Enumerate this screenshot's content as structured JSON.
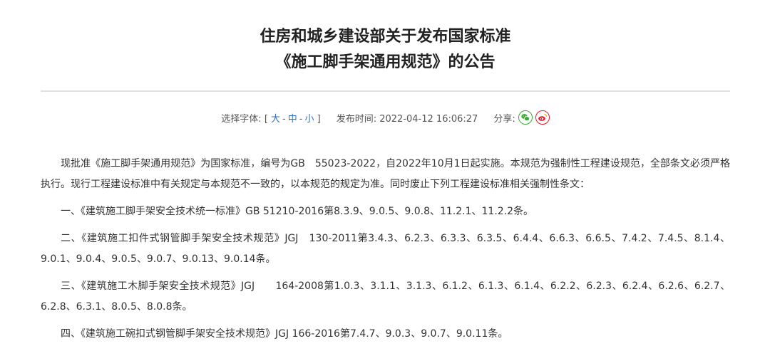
{
  "article": {
    "title_line1": "住房和城乡建设部关于发布国家标准",
    "title_line2": "《施工脚手架通用规范》的公告"
  },
  "meta": {
    "font_label": "选择字体:",
    "bracket_open": "[",
    "bracket_close": "]",
    "size_large": "大",
    "size_medium": "中",
    "size_small": "小",
    "size_sep": "-",
    "publish_label": "发布时间:",
    "publish_time": "2022-04-12 16:06:27",
    "share_label": "分享:",
    "share_icons": [
      "wechat-icon",
      "weibo-icon"
    ],
    "colors": {
      "wechat": "#3aaa35",
      "weibo": "#e6162d",
      "link": "#2e6fc4"
    }
  },
  "paragraphs": [
    "现批准《施工脚手架通用规范》为国家标准，编号为GB　55023-2022，自2022年10月1日起实施。本规范为强制性工程建设规范，全部条文必须严格执行。现行工程建设标准中有关规定与本规范不一致的，以本规范的规定为准。同时废止下列工程建设标准相关强制性条文：",
    "一、《建筑施工脚手架安全技术统一标准》GB 51210-2016第8.3.9、9.0.5、9.0.8、11.2.1、11.2.2条。",
    "二、《建筑施工扣件式钢管脚手架安全技术规范》JGJ　130-2011第3.4.3、6.2.3、6.3.3、6.3.5、6.4.4、6.6.3、6.6.5、7.4.2、7.4.5、8.1.4、9.0.1、9.0.4、9.0.5、9.0.7、9.0.13、9.0.14条。",
    "三、《建筑施工木脚手架安全技术规范》JGJ　　164-2008第1.0.3、3.1.1、3.1.3、6.1.2、6.1.3、6.1.4、6.2.2、6.2.3、6.2.4、6.2.6、6.2.7、6.2.8、6.3.1、8.0.5、8.0.8条。",
    "四、《建筑施工碗扣式钢管脚手架安全技术规范》JGJ 166-2016第7.4.7、9.0.3、9.0.7、9.0.11条。"
  ]
}
